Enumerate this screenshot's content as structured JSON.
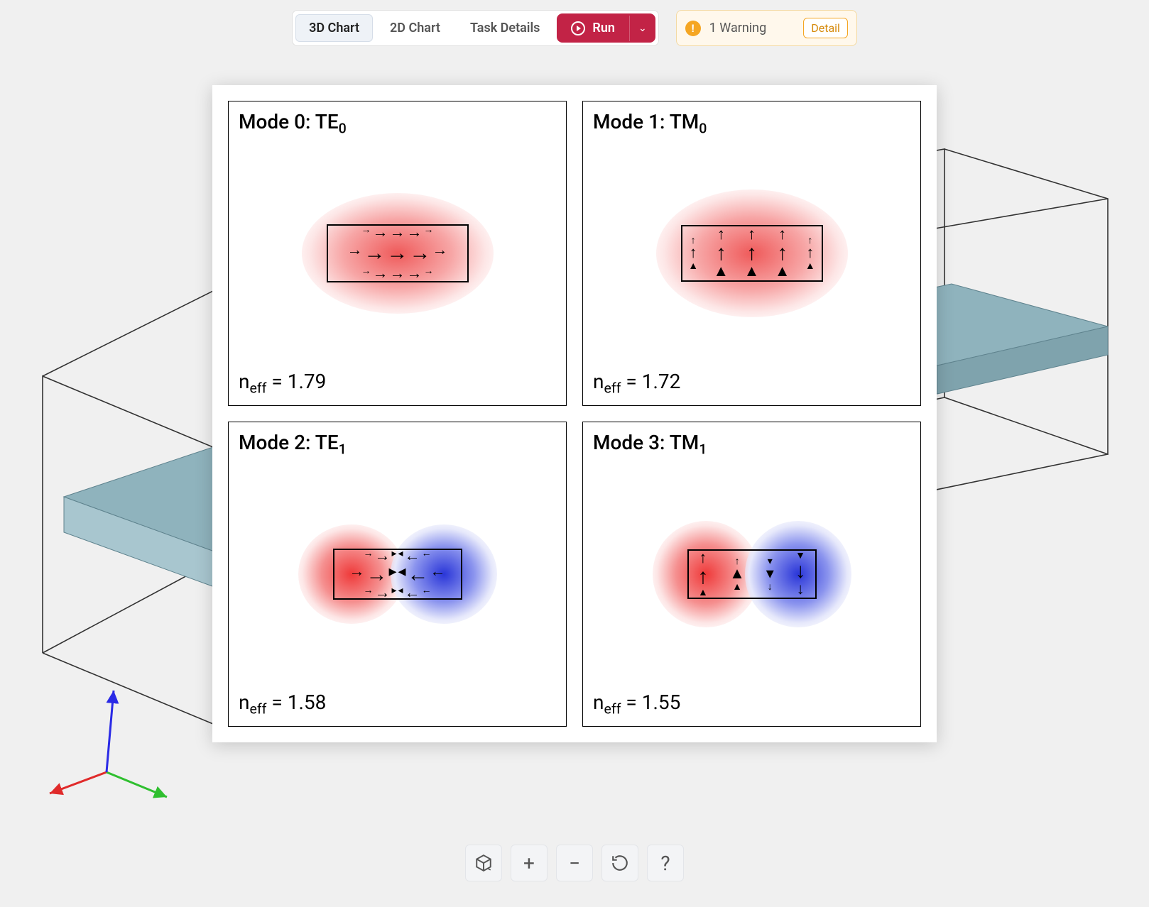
{
  "toolbar": {
    "tabs": {
      "chart3d": "3D Chart",
      "chart2d": "2D Chart",
      "taskdetails": "Task Details"
    },
    "run_label": "Run",
    "warning": {
      "text": "1 Warning",
      "detail_label": "Detail"
    }
  },
  "modes": [
    {
      "title": "Mode 0: TE",
      "title_sub": "0",
      "neff_label": "n",
      "neff_sub": "eff",
      "neff_value": "1.79",
      "polarization": "TE",
      "lobes": 1
    },
    {
      "title": "Mode 1: TM",
      "title_sub": "0",
      "neff_label": "n",
      "neff_sub": "eff",
      "neff_value": "1.72",
      "polarization": "TM",
      "lobes": 1
    },
    {
      "title": "Mode 2: TE",
      "title_sub": "1",
      "neff_label": "n",
      "neff_sub": "eff",
      "neff_value": "1.58",
      "polarization": "TE",
      "lobes": 2
    },
    {
      "title": "Mode 3: TM",
      "title_sub": "1",
      "neff_label": "n",
      "neff_sub": "eff",
      "neff_value": "1.55",
      "polarization": "TM",
      "lobes": 2
    }
  ],
  "chart_data": [
    {
      "type": "mode_field",
      "mode_index": 0,
      "label": "TE0",
      "n_eff": 1.79,
      "E_direction": "horizontal",
      "lobes": 1,
      "lobe_signs": [
        "+"
      ]
    },
    {
      "type": "mode_field",
      "mode_index": 1,
      "label": "TM0",
      "n_eff": 1.72,
      "E_direction": "vertical",
      "lobes": 1,
      "lobe_signs": [
        "+"
      ]
    },
    {
      "type": "mode_field",
      "mode_index": 2,
      "label": "TE1",
      "n_eff": 1.58,
      "E_direction": "horizontal",
      "lobes": 2,
      "lobe_signs": [
        "+",
        "-"
      ]
    },
    {
      "type": "mode_field",
      "mode_index": 3,
      "label": "TM1",
      "n_eff": 1.55,
      "E_direction": "vertical",
      "lobes": 2,
      "lobe_signs": [
        "+",
        "-"
      ]
    }
  ],
  "bottom_tools": {
    "cube": "3d-view",
    "plus": "zoom-in",
    "minus": "zoom-out",
    "reset": "reset",
    "help": "help"
  },
  "colors": {
    "run": "#c22346",
    "warn_bg": "#fff8ec",
    "warn_accent": "#f5a623",
    "field_pos": "#e33e3e",
    "field_neg": "#2a3be0"
  }
}
